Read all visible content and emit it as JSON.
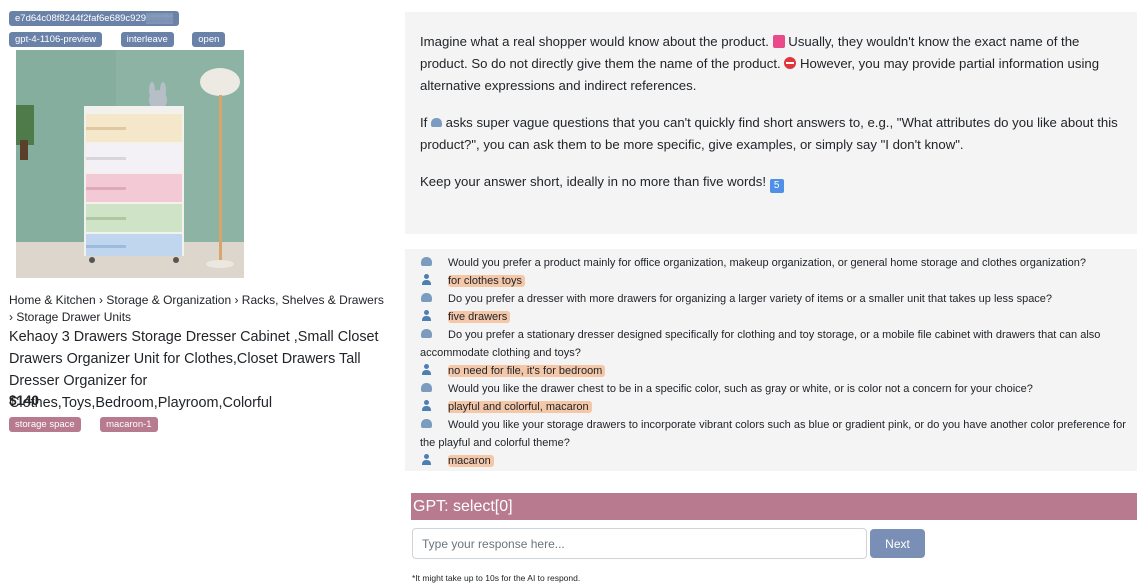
{
  "badges": {
    "session_id": "e7d64c08f8244f2faf6e689c929",
    "session_id_blurred": "▒▒▒▒",
    "model": "gpt-4-1106-preview",
    "mode": "interleave",
    "status": "open"
  },
  "product": {
    "breadcrumb": "Home & Kitchen › Storage & Organization › Racks, Shelves & Drawers › Storage Drawer Units",
    "title": "Kehaoy 3 Drawers Storage Dresser Cabinet ,Small Closet Drawers Organizer Unit for Clothes,Closet Drawers Tall Dresser Organizer for Clothes,Toys,Bedroom,Playroom,Colorful",
    "price": "$140",
    "tags": [
      "storage space",
      "macaron-1"
    ]
  },
  "instructions": {
    "p1_a": "Imagine what a real shopper would know about the product. ",
    "p1_b": " Usually, they wouldn't know the exact name of the product. So do not directly give them the name of the product. ",
    "p1_c": " However, you may provide partial information using alternative expressions and indirect references.",
    "p2_a": "If ",
    "p2_b": " asks super vague questions that you can't quickly find short answers to, e.g., \"What attributes do you like about this product?\", you can ask them to be more specific, give examples, or simply say \"I don't know\".",
    "p3": "Keep your answer short, ideally in no more than five words! ",
    "five_emoji": "5"
  },
  "chat": [
    {
      "role": "ai",
      "text": "Would you prefer a product mainly for office organization, makeup organization, or general home storage and clothes organization?"
    },
    {
      "role": "user",
      "text": "for clothes toys"
    },
    {
      "role": "ai",
      "text": "Do you prefer a dresser with more drawers for organizing a larger variety of items or a smaller unit that takes up less space?"
    },
    {
      "role": "user",
      "text": "five drawers"
    },
    {
      "role": "ai",
      "text": "Do you prefer a stationary dresser designed specifically for clothing and toy storage, or a mobile file cabinet with drawers that can also accommodate clothing and toys?"
    },
    {
      "role": "user",
      "text": "no need for file, it's for bedroom"
    },
    {
      "role": "ai",
      "text": "Would you like the drawer chest to be in a specific color, such as gray or white, or is color not a concern for your choice?"
    },
    {
      "role": "user",
      "text": "playful and colorful, macaron"
    },
    {
      "role": "ai",
      "text": "Would you like your storage drawers to incorporate vibrant colors such as blue or gradient pink, or do you have another color preference for the playful and colorful theme?"
    },
    {
      "role": "user",
      "text": "macaron"
    }
  ],
  "gpt_status": "GPT: select[0]",
  "response": {
    "placeholder": "Type your response here...",
    "value": "",
    "next_label": "Next"
  },
  "note": "*It might take up to 10s for the AI to respond.",
  "colors": {
    "badge": "#6b82a8",
    "tag": "#b87a8e",
    "gpt_bar": "#b87a8e",
    "user_highlight": "#f4c7a9",
    "next_button": "#7a8fb5"
  }
}
